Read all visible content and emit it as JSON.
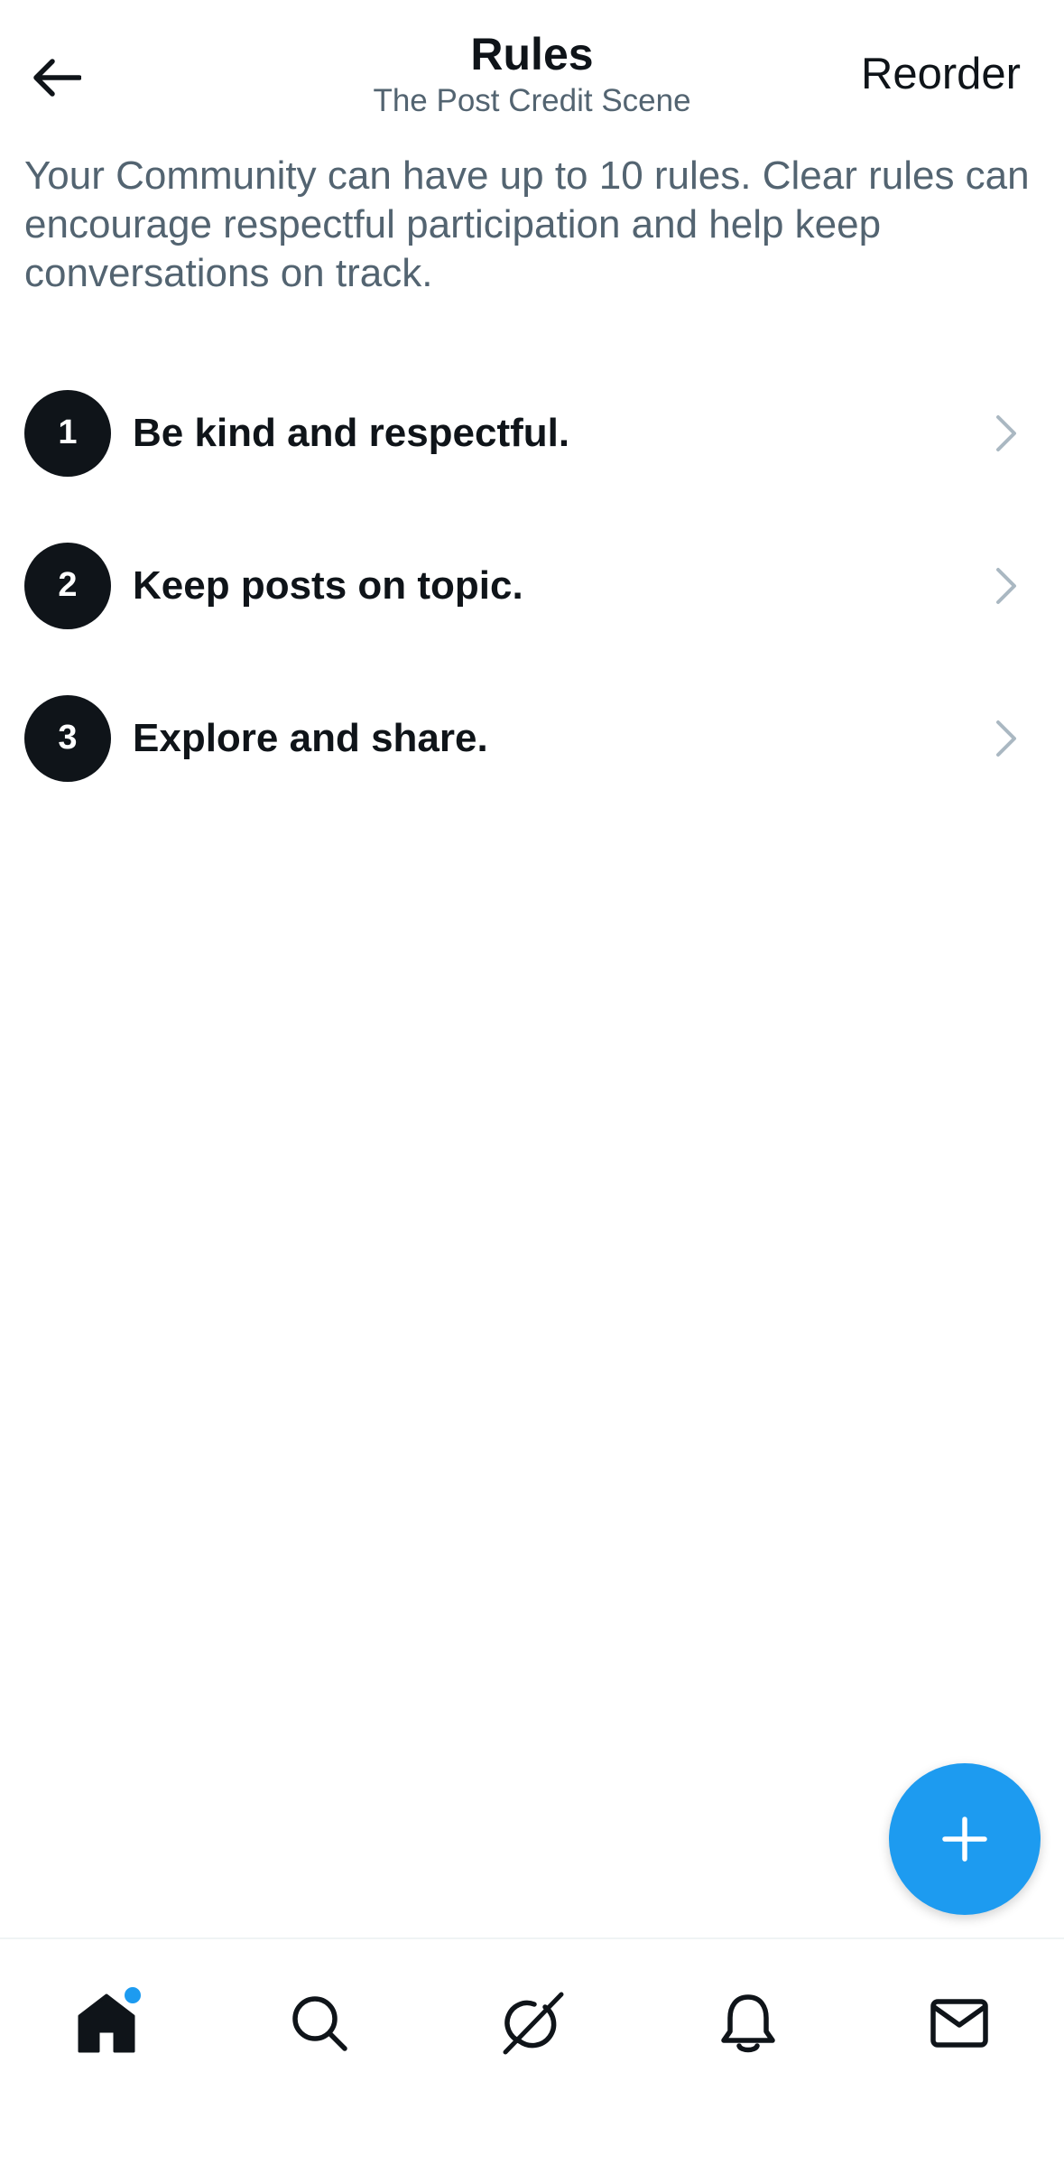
{
  "header": {
    "title": "Rules",
    "subtitle": "The Post Credit Scene",
    "reorder_label": "Reorder",
    "back_icon": "arrow-left-icon"
  },
  "description": "Your Community can have up to 10 rules. Clear rules can encourage respectful participation and help keep conversations on track.",
  "rules": [
    {
      "number": "1",
      "text": "Be kind and respectful."
    },
    {
      "number": "2",
      "text": "Keep posts on topic."
    },
    {
      "number": "3",
      "text": "Explore and share."
    }
  ],
  "fab": {
    "icon": "plus-icon"
  },
  "tabbar": {
    "items": [
      {
        "icon": "home-icon",
        "active": true,
        "has_notification_dot": true
      },
      {
        "icon": "search-icon",
        "active": false
      },
      {
        "icon": "grok-icon",
        "active": false
      },
      {
        "icon": "bell-icon",
        "active": false
      },
      {
        "icon": "mail-icon",
        "active": false
      }
    ]
  },
  "colors": {
    "accent": "#1d9bf0",
    "text_primary": "#0f1419",
    "text_secondary": "#536471",
    "chevron": "#aab8c2"
  }
}
